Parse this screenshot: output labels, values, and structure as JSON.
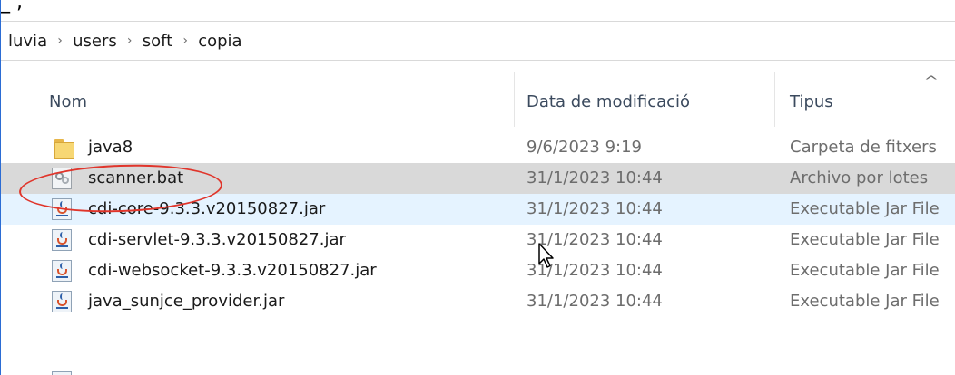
{
  "breadcrumb": {
    "items": [
      "luvia",
      "users",
      "soft",
      "copia"
    ],
    "separator": "›"
  },
  "columns": {
    "name": "Nom",
    "date": "Data de modificació",
    "type": "Tipus"
  },
  "files": [
    {
      "name": "java8",
      "date": "9/6/2023 9:19",
      "type": "Carpeta de fitxers",
      "icon": "folder-icon"
    },
    {
      "name": "scanner.bat",
      "date": "31/1/2023 10:44",
      "type": "Archivo por lotes",
      "icon": "batch-file-icon",
      "selected": true
    },
    {
      "name": "cdi-core-9.3.3.v20150827.jar",
      "date": "31/1/2023 10:44",
      "type": "Executable Jar File",
      "icon": "jar-file-icon",
      "hovered": true
    },
    {
      "name": "cdi-servlet-9.3.3.v20150827.jar",
      "date": "31/1/2023 10:44",
      "type": "Executable Jar File",
      "icon": "jar-file-icon"
    },
    {
      "name": "cdi-websocket-9.3.3.v20150827.jar",
      "date": "31/1/2023 10:44",
      "type": "Executable Jar File",
      "icon": "jar-file-icon"
    },
    {
      "name": "java_sunjce_provider.jar",
      "date": "31/1/2023 10:44",
      "type": "Executable Jar File",
      "icon": "jar-file-icon"
    }
  ],
  "colors": {
    "selected_row": "#d9d9d9",
    "hover_row": "#e5f3ff",
    "annotation": "#e0352b",
    "window_border": "#2b6cd4"
  }
}
